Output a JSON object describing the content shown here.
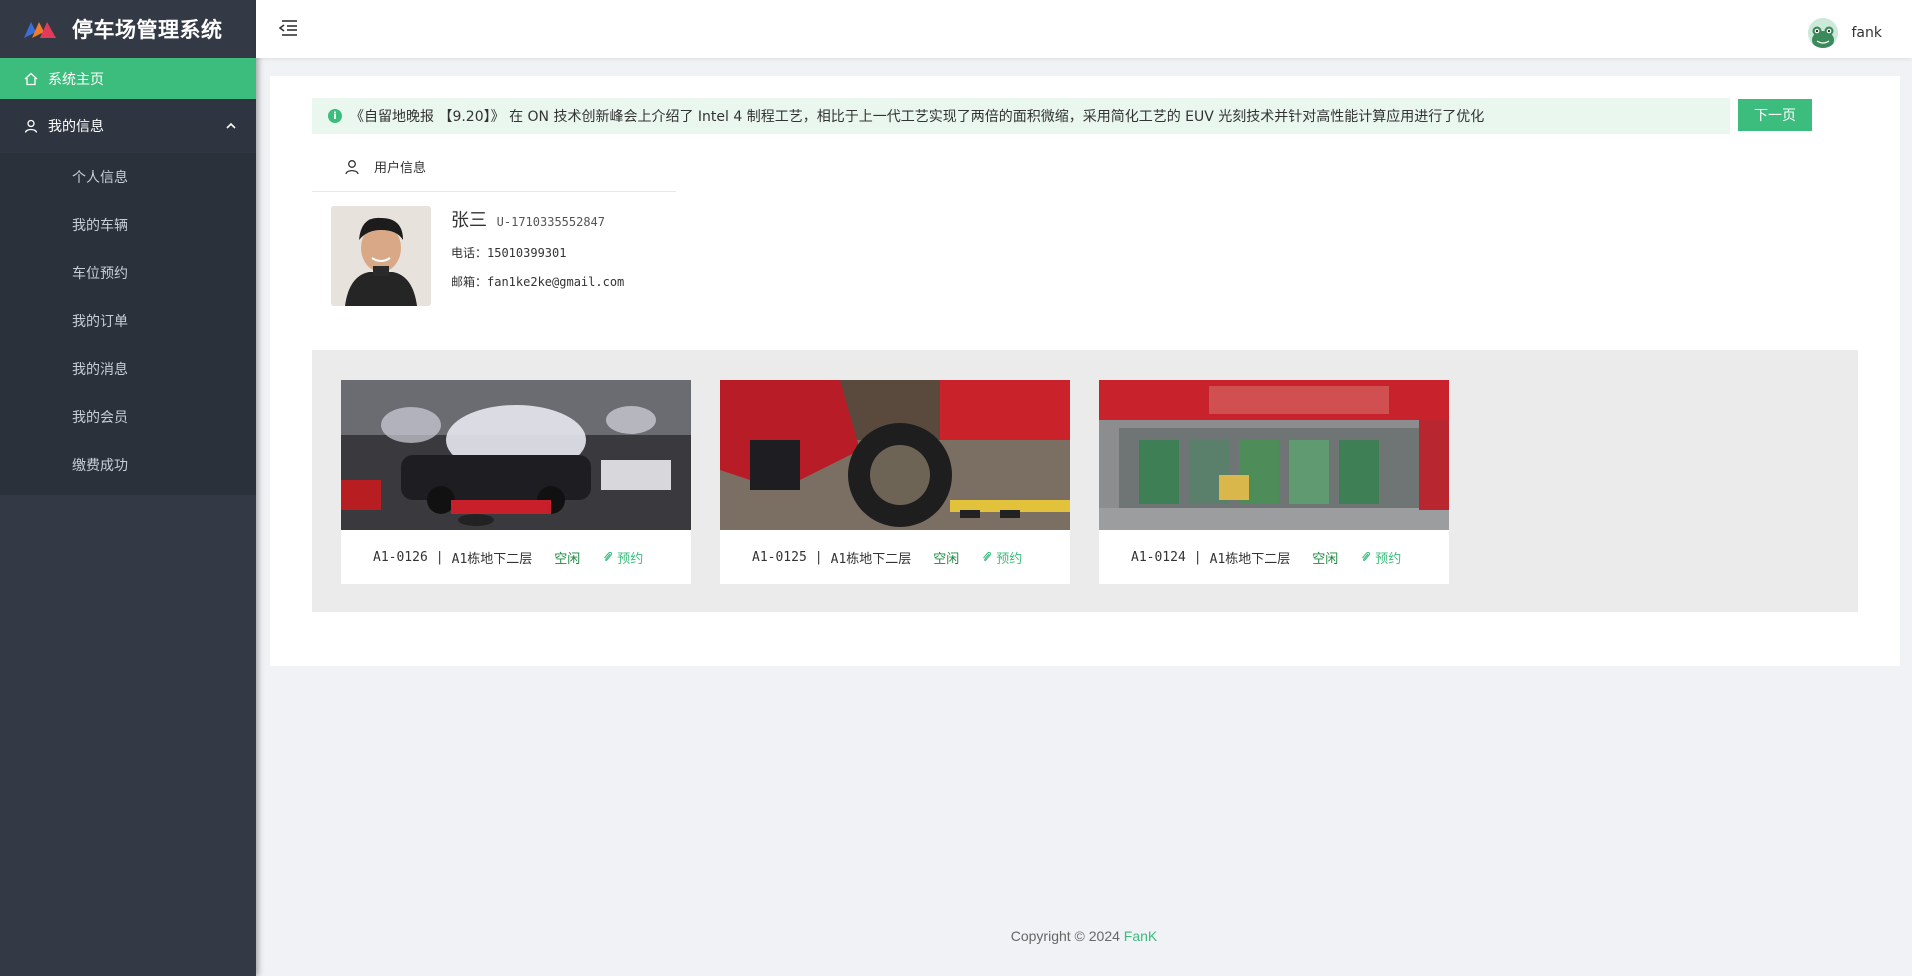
{
  "app": {
    "title": "停车场管理系统"
  },
  "sidebar": {
    "home": "系统主页",
    "group": "我的信息",
    "items": [
      {
        "label": "个人信息"
      },
      {
        "label": "我的车辆"
      },
      {
        "label": "车位预约"
      },
      {
        "label": "我的订单"
      },
      {
        "label": "我的消息"
      },
      {
        "label": "我的会员"
      },
      {
        "label": "缴费成功"
      }
    ]
  },
  "header": {
    "username": "fank"
  },
  "notice": {
    "text": "《自留地晚报 【9.20】》 在 ON 技术创新峰会上介绍了 Intel 4 制程工艺，相比于上一代工艺实现了两倍的面积微缩，采用简化工艺的 EUV 光刻技术并针对高性能计算应用进行了优化",
    "next_label": "下一页"
  },
  "user_tab": {
    "label": "用户信息"
  },
  "profile": {
    "name": "张三",
    "uid": "U-1710335552847",
    "phone": "电话：15010399301",
    "email": "邮箱：fan1ke2ke@gmail.com"
  },
  "spots": [
    {
      "code": "A1-0126",
      "sep": "|",
      "location": "A1栋地下二层",
      "status": "空闲",
      "action": "预约"
    },
    {
      "code": "A1-0125",
      "sep": "|",
      "location": "A1栋地下二层",
      "status": "空闲",
      "action": "预约"
    },
    {
      "code": "A1-0124",
      "sep": "|",
      "location": "A1栋地下二层",
      "status": "空闲",
      "action": "预约"
    }
  ],
  "footer": {
    "copyright": "Copyright © 2024",
    "author": "FanK"
  },
  "colors": {
    "accent": "#3dbd7d",
    "sidebar": "#343a45",
    "status": "#1e8a3f"
  }
}
